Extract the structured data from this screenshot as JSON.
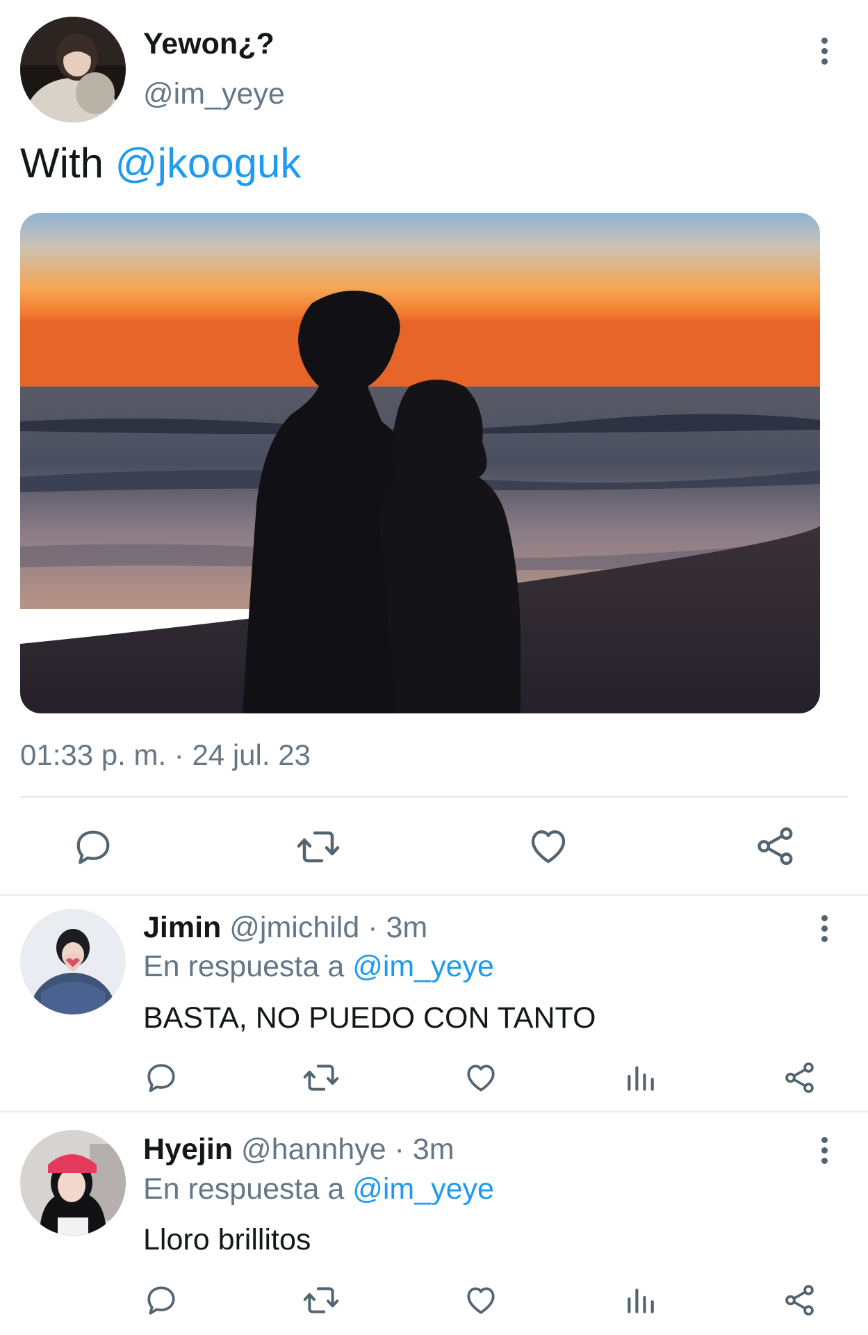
{
  "tweet": {
    "author_name": "Yewon¿?",
    "author_handle": "@im_yeye",
    "text_prefix": "With",
    "text_mention": "@jkooguk",
    "timestamp": "01:33 p. m. · 24 jul. 23"
  },
  "replies": [
    {
      "name": "Jimin",
      "handle": "@jmichild",
      "time": "· 3m",
      "reply_prefix": "En respuesta a",
      "reply_to": "@im_yeye",
      "text": "BASTA, NO PUEDO CON TANTO"
    },
    {
      "name": "Hyejin",
      "handle": "@hannhye",
      "time": "· 3m",
      "reply_prefix": "En respuesta a",
      "reply_to": "@im_yeye",
      "text": "Lloro brillitos"
    }
  ],
  "icons": {
    "reply": "speech-bubble-icon",
    "retweet": "retweet-icon",
    "like": "heart-icon",
    "stats": "bar-chart-icon",
    "share": "share-icon",
    "more": "more-vertical-icon"
  },
  "colors": {
    "link": "#1d9bf0",
    "muted_text": "#657786",
    "icon": "#536471",
    "divider": "#eceff1"
  }
}
